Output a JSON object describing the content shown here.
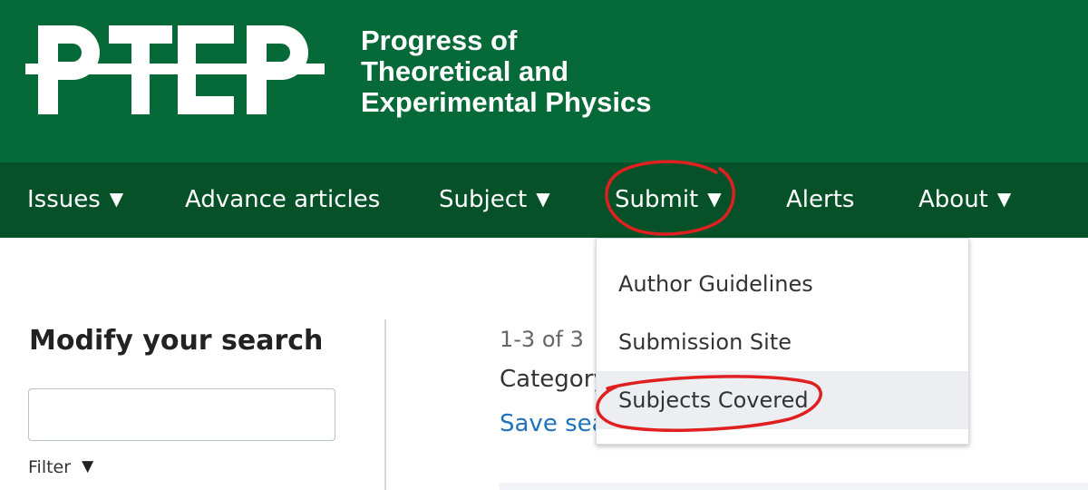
{
  "header": {
    "logo_text": "PTEP",
    "journal_name": [
      "Progress of",
      "Theoretical and",
      "Experimental Physics"
    ]
  },
  "nav": {
    "items": [
      {
        "label": "Issues",
        "has_caret": true
      },
      {
        "label": "Advance articles",
        "has_caret": false
      },
      {
        "label": "Subject",
        "has_caret": true
      },
      {
        "label": "Submit",
        "has_caret": true
      },
      {
        "label": "Alerts",
        "has_caret": false
      },
      {
        "label": "About",
        "has_caret": true
      }
    ],
    "caret": "▼"
  },
  "dropdown": {
    "items": [
      "Author Guidelines",
      "Submission Site",
      "Subjects Covered"
    ],
    "highlighted_item": "Subjects Covered"
  },
  "sidebar": {
    "title": "Modify your search",
    "search_value": "",
    "filter_label": "Filter"
  },
  "results": {
    "count_text": "1-3 of 3",
    "category_text": "Category",
    "save_search_text": "Save sea"
  },
  "colors": {
    "header_bg": "#066a38",
    "nav_bg": "#075129",
    "link": "#1e73be",
    "annotation": "#e02020"
  }
}
